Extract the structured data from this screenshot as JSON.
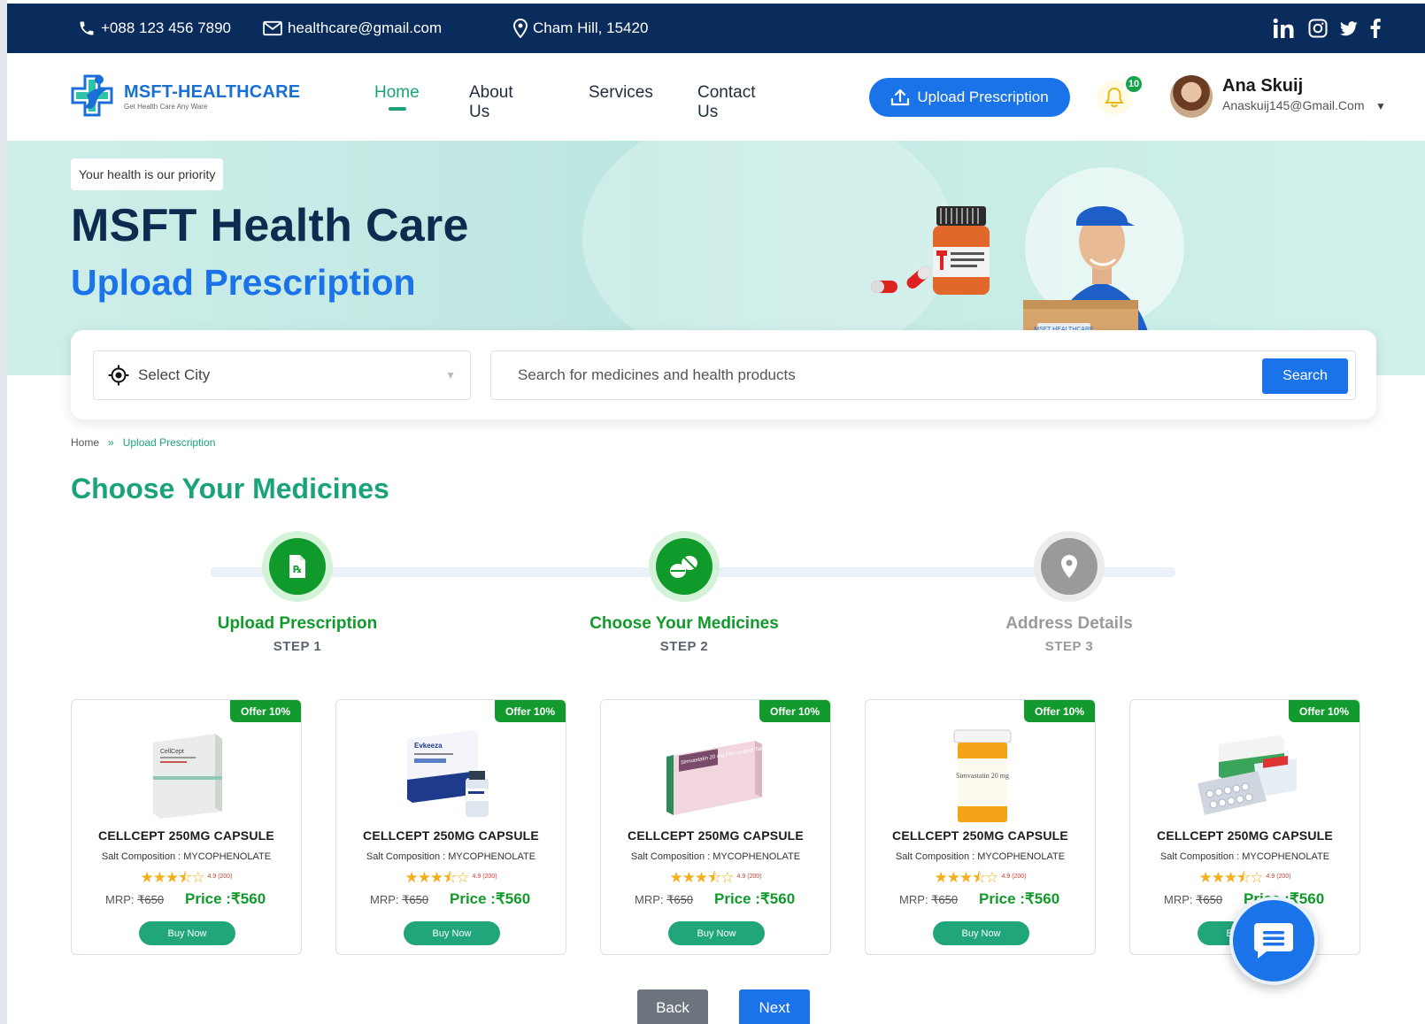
{
  "topbar": {
    "phone": "+088 123 456 7890",
    "email": "healthcare@gmail.com",
    "location": "Cham Hill, 15420",
    "socials": [
      "linkedin-icon",
      "instagram-icon",
      "twitter-icon",
      "facebook-icon"
    ]
  },
  "header": {
    "logo_name": "MSFT-HEALTHCARE",
    "logo_tagline": "Get Health Care Any Ware",
    "nav": [
      "Home",
      "About Us",
      "Services",
      "Contact Us"
    ],
    "active_nav": "Home",
    "upload_button": "Upload Prescription",
    "notification_count": "10",
    "user_name": "Ana Skuij",
    "user_email": "Anaskuij145@Gmail.Com"
  },
  "hero": {
    "tag": "Your health is our priority",
    "title": "MSFT Health Care",
    "subtitle": "Upload Prescription",
    "box_label": "MSFT HEALTHCARE"
  },
  "search": {
    "city_placeholder": "Select City",
    "query_placeholder": "Search for medicines and health products",
    "button": "Search"
  },
  "breadcrumb": {
    "home": "Home",
    "separator": "»",
    "current": "Upload Prescription"
  },
  "section_title": "Choose Your Medicines",
  "steps": [
    {
      "label": "Upload Prescription",
      "num": "STEP 1",
      "state": "done"
    },
    {
      "label": "Choose Your Medicines",
      "num": "STEP 2",
      "state": "done"
    },
    {
      "label": "Address Details",
      "num": "STEP 3",
      "state": "todo"
    }
  ],
  "products": [
    {
      "offer": "Offer 10%",
      "name": "CELLCEPT 250MG CAPSULE",
      "salt": "Salt Composition : MYCOPHENOLATE",
      "stars": "★★★⯪☆",
      "rating": "4.9 (200)",
      "mrp_label": "MRP:",
      "mrp": "₹650",
      "price": "Price :₹560",
      "buy": "Buy Now",
      "image": "cellcept-box"
    },
    {
      "offer": "Offer 10%",
      "name": "CELLCEPT 250MG CAPSULE",
      "salt": "Salt Composition : MYCOPHENOLATE",
      "stars": "★★★⯪☆",
      "rating": "4.9 (200)",
      "mrp_label": "MRP:",
      "mrp": "₹650",
      "price": "Price :₹560",
      "buy": "Buy Now",
      "image": "evkeeza-box"
    },
    {
      "offer": "Offer 10%",
      "name": "CELLCEPT 250MG CAPSULE",
      "salt": "Salt Composition : MYCOPHENOLATE",
      "stars": "★★★⯪☆",
      "rating": "4.9 (200)",
      "mrp_label": "MRP:",
      "mrp": "₹650",
      "price": "Price :₹560",
      "buy": "Buy Now",
      "image": "simvastatin-box"
    },
    {
      "offer": "Offer 10%",
      "name": "CELLCEPT 250MG CAPSULE",
      "salt": "Salt Composition : MYCOPHENOLATE",
      "stars": "★★★⯪☆",
      "rating": "4.9 (200)",
      "mrp_label": "MRP:",
      "mrp": "₹650",
      "price": "Price :₹560",
      "buy": "Buy Now",
      "image": "simvastatin-bottle"
    },
    {
      "offer": "Offer 10%",
      "name": "CELLCEPT 250MG CAPSULE",
      "salt": "Salt Composition : MYCOPHENOLATE",
      "stars": "★★★⯪☆",
      "rating": "4.9 (200)",
      "mrp_label": "MRP:",
      "mrp": "₹650",
      "price": "Price :₹560",
      "buy": "Buy Now",
      "image": "blister-pack"
    }
  ],
  "product_images": {
    "simvastatin_box_text": "Simvastatin 20 mg Film-coated Tablets",
    "simvastatin_bottle_text": "Simvastatin 20 mg",
    "evkeeza_text": "Evkeeza",
    "cellcept_text": "CellCept"
  },
  "buttons": {
    "back": "Back",
    "next": "Next"
  },
  "colors": {
    "navy": "#0a2c5c",
    "brand_blue": "#1a73e8",
    "teal": "#1aa37a",
    "green": "#119a2c",
    "hero_bg": "#c4e9e3"
  }
}
